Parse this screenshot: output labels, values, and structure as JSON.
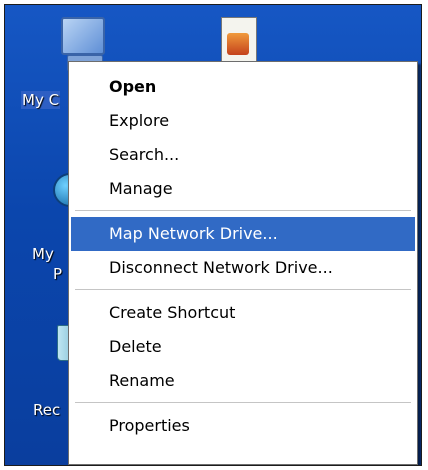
{
  "desktop": {
    "icons": [
      {
        "label": "My C",
        "icon": "my-computer-icon"
      },
      {
        "label": "My",
        "icon": "my-network-places-icon",
        "label2": "P"
      },
      {
        "label": "Rec",
        "icon": "recycle-bin-icon"
      },
      {
        "label": "",
        "icon": "document-icon"
      }
    ]
  },
  "context_menu": {
    "groups": [
      [
        {
          "label": "Open",
          "bold": true
        },
        {
          "label": "Explore"
        },
        {
          "label": "Search..."
        },
        {
          "label": "Manage"
        }
      ],
      [
        {
          "label": "Map Network Drive...",
          "highlighted": true
        },
        {
          "label": "Disconnect Network Drive..."
        }
      ],
      [
        {
          "label": "Create Shortcut"
        },
        {
          "label": "Delete"
        },
        {
          "label": "Rename"
        }
      ],
      [
        {
          "label": "Properties"
        }
      ]
    ]
  },
  "colors": {
    "desktop_background": "#0b46ad",
    "menu_highlight": "#316ac5",
    "menu_background": "#ffffff"
  }
}
